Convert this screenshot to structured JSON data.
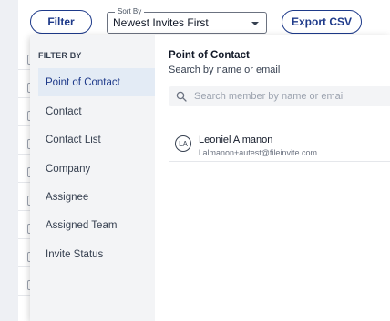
{
  "toolbar": {
    "filter_label": "Filter",
    "sort": {
      "legend": "Sort By",
      "value": "Newest Invites First"
    },
    "export_label": "Export CSV"
  },
  "filter_panel": {
    "heading": "FILTER BY",
    "items": [
      {
        "label": "Point of Contact",
        "active": true
      },
      {
        "label": "Contact"
      },
      {
        "label": "Contact List"
      },
      {
        "label": "Company"
      },
      {
        "label": "Assignee"
      },
      {
        "label": "Assigned Team"
      },
      {
        "label": "Invite Status"
      }
    ],
    "detail": {
      "title": "Point of Contact",
      "subtitle": "Search by name or email",
      "search_placeholder": "Search member by name or email",
      "results": [
        {
          "initials": "LA",
          "name": "Leoniel Almanon",
          "email": "l.almanon+autest@fileinvite.com"
        }
      ]
    }
  },
  "colors": {
    "accent": "#1e3a8a",
    "active_bg": "#e3ebf5",
    "panel_left_bg": "#f3f4f6"
  },
  "icons": {
    "search": "search-icon",
    "dropdown": "chevron-down-icon"
  }
}
